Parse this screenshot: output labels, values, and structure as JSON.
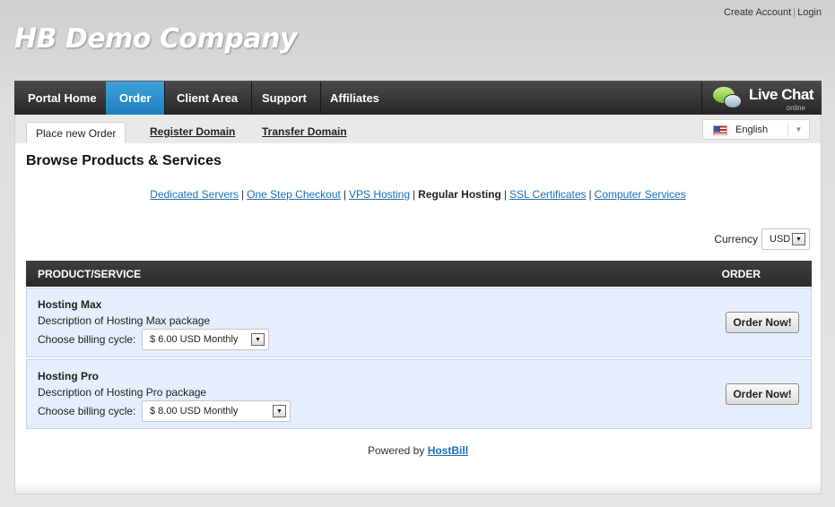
{
  "top_links": {
    "create_account": "Create Account",
    "separator": "|",
    "login": "Login"
  },
  "logo": {
    "text": "HB Demo Company"
  },
  "nav": {
    "items": [
      {
        "label": "Portal Home",
        "active": false
      },
      {
        "label": "Order",
        "active": true
      },
      {
        "label": "Client Area",
        "active": false
      },
      {
        "label": "Support",
        "active": false
      },
      {
        "label": "Affiliates",
        "active": false
      }
    ],
    "live_chat": {
      "title": "Live Chat",
      "status": "online"
    }
  },
  "subtabs": {
    "items": [
      {
        "label": "Place new Order",
        "active": true
      },
      {
        "label": "Register Domain",
        "active": false
      },
      {
        "label": "Transfer Domain",
        "active": false
      }
    ]
  },
  "language": {
    "selected": "English",
    "icon": "us-flag-icon"
  },
  "page_title": "Browse Products & Services",
  "categories": {
    "separator": "|",
    "items": [
      {
        "label": "Dedicated Servers",
        "current": false
      },
      {
        "label": "One Step Checkout",
        "current": false
      },
      {
        "label": "VPS Hosting",
        "current": false
      },
      {
        "label": "Regular Hosting",
        "current": true
      },
      {
        "label": "SSL Certificates",
        "current": false
      },
      {
        "label": "Computer Services",
        "current": false
      }
    ]
  },
  "currency": {
    "label": "Currency",
    "selected": "USD"
  },
  "table": {
    "header_product": "PRODUCT/SERVICE",
    "header_order": "ORDER",
    "cycle_label": "Choose billing cycle:",
    "order_button": "Order Now!",
    "rows": [
      {
        "name": "Hosting Max",
        "description": "Description of Hosting Max package",
        "billing": "$ 6.00 USD Monthly"
      },
      {
        "name": "Hosting Pro",
        "description": "Description of Hosting Pro package",
        "billing": "$ 8.00 USD Monthly"
      }
    ]
  },
  "footer": {
    "powered_by": "Powered by",
    "brand": "HostBill"
  },
  "colors": {
    "accent": "#2b90cc",
    "nav_bg": "#333333",
    "link": "#1a6fb8",
    "row_bg": "#e5eefc"
  }
}
